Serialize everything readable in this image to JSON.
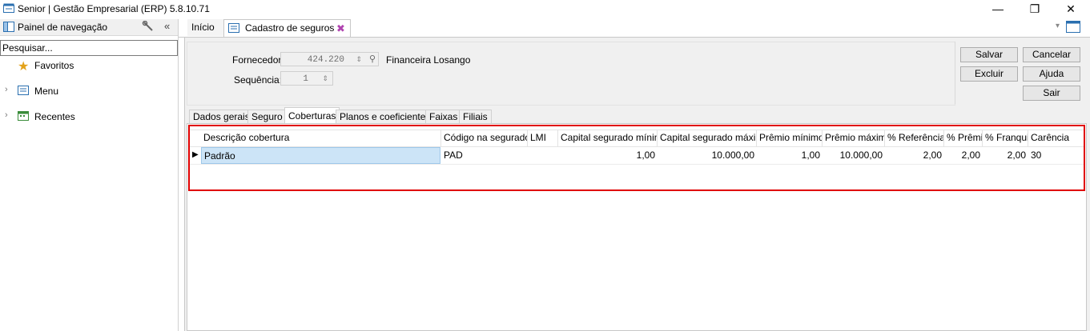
{
  "window": {
    "title": "Senior | Gestão Empresarial (ERP) 5.8.10.71",
    "minimize": "—",
    "maximize": "❐",
    "close": "✕"
  },
  "nav": {
    "title": "Painel de navegação",
    "search_value": "Pesquisar...",
    "collapse_icon": "«",
    "items": [
      {
        "label": "Favoritos",
        "icon": "star-icon"
      },
      {
        "label": "Menu",
        "icon": "menu-list-icon"
      },
      {
        "label": "Recentes",
        "icon": "recent-calendar-icon"
      }
    ]
  },
  "doc_tabs": [
    {
      "label": "Início"
    },
    {
      "label": "Cadastro de seguros"
    }
  ],
  "form": {
    "fornecedor_label": "Fornecedor:",
    "fornecedor_value": "424.220",
    "fornecedor_name": "Financeira Losango",
    "sequencia_label": "Sequência:",
    "sequencia_value": "1"
  },
  "buttons": {
    "salvar": "Salvar",
    "cancelar": "Cancelar",
    "excluir": "Excluir",
    "ajuda": "Ajuda",
    "sair": "Sair"
  },
  "inner_tabs": [
    {
      "label": "Dados gerais"
    },
    {
      "label": "Seguro"
    },
    {
      "label": "Coberturas",
      "active": true
    },
    {
      "label": "Planos e coeficientes"
    },
    {
      "label": "Faixas"
    },
    {
      "label": "Filiais"
    }
  ],
  "grid": {
    "columns": [
      "Descrição cobertura",
      "Código na seguradora",
      "LMI",
      "Capital segurado mínimo",
      "Capital segurado máximo",
      "Prêmio mínimo",
      "Prêmio máximo",
      "% Referência",
      "% Prêmio",
      "% Franquia",
      "Carência"
    ],
    "rows": [
      [
        "Padrão",
        "PAD",
        "",
        "1,00",
        "10.000,00",
        "1,00",
        "10.000,00",
        "2,00",
        "2,00",
        "2,00",
        "30"
      ]
    ]
  },
  "colors": {
    "highlight_frame": "#e00000",
    "selected_cell": "#cce4f7"
  }
}
